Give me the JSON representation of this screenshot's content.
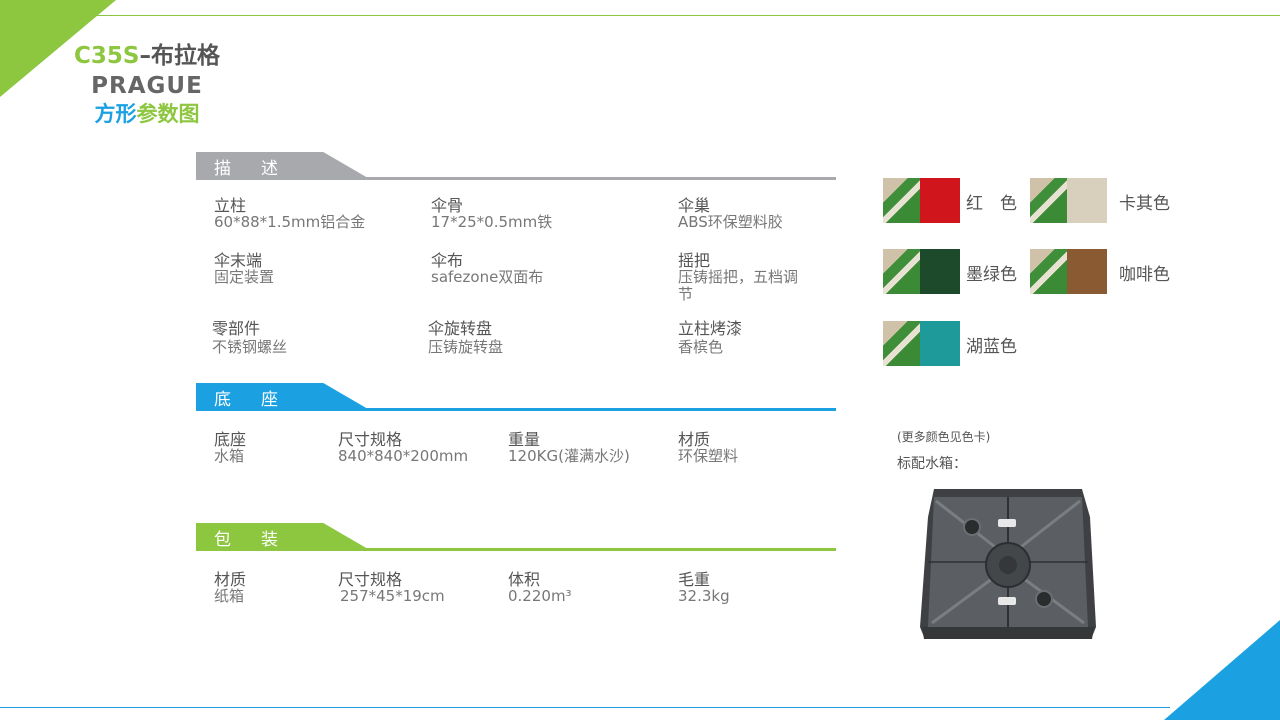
{
  "title": {
    "model": "C35S",
    "dash_name": "–布拉格",
    "english": "PRAGUE",
    "sub_blue": "方形",
    "sub_green": "参数图"
  },
  "sections": {
    "desc": {
      "header": "描述",
      "items": [
        {
          "label": "立柱",
          "value": "60*88*1.5mm铝合金"
        },
        {
          "label": "伞骨",
          "value": "17*25*0.5mm铁"
        },
        {
          "label": "伞巢",
          "value": "ABS环保塑料胶"
        },
        {
          "label": "伞末端",
          "value": "固定装置"
        },
        {
          "label": "伞布",
          "value": "safezone双面布"
        },
        {
          "label": "摇把",
          "value": "压铸摇把，五档调节"
        },
        {
          "label": "零部件",
          "value": "不锈钢螺丝"
        },
        {
          "label": "伞旋转盘",
          "value": "压铸旋转盘"
        },
        {
          "label": "立柱烤漆",
          "value": "香槟色"
        }
      ]
    },
    "base": {
      "header": "底座",
      "items": [
        {
          "label": "底座",
          "value": "水箱"
        },
        {
          "label": "尺寸规格",
          "value": "840*840*200mm"
        },
        {
          "label": "重量",
          "value": "120KG(灌满水沙)"
        },
        {
          "label": "材质",
          "value": "环保塑料"
        }
      ]
    },
    "pack": {
      "header": "包装",
      "items": [
        {
          "label": "材质",
          "value": "纸箱"
        },
        {
          "label": "尺寸规格",
          "value": "257*45*19cm"
        },
        {
          "label": "体积",
          "value": "0.220m³"
        },
        {
          "label": "毛重",
          "value": "32.3kg"
        }
      ]
    }
  },
  "colors": [
    {
      "name": "红　色",
      "hex": "#d0161c"
    },
    {
      "name": "卡其色",
      "hex": "#d8cfbd"
    },
    {
      "name": "墨绿色",
      "hex": "#1d4a2b"
    },
    {
      "name": "咖啡色",
      "hex": "#8a5a33"
    },
    {
      "name": "湖蓝色",
      "hex": "#1f9a9a"
    }
  ],
  "notes": {
    "more_colors": "(更多颜色见色卡)",
    "standard_tank": "标配水箱："
  },
  "theme": {
    "green": "#8dc63f",
    "blue": "#1ba1e2",
    "gray": "#a7a9ac"
  }
}
